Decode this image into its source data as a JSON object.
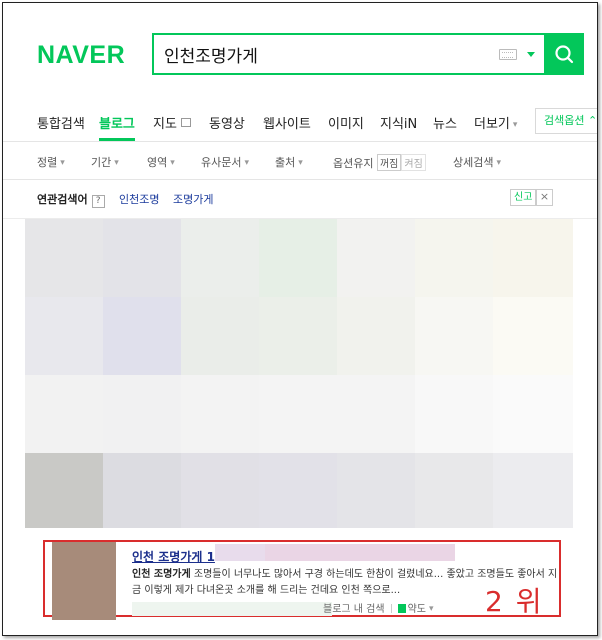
{
  "header": {
    "logo": "NAVER",
    "query": "인천조명가게"
  },
  "tabs": [
    {
      "label": "통합검색"
    },
    {
      "label": "블로그"
    },
    {
      "label": "지도"
    },
    {
      "label": "동영상"
    },
    {
      "label": "웹사이트"
    },
    {
      "label": "이미지"
    },
    {
      "label": "지식iN"
    },
    {
      "label": "뉴스"
    },
    {
      "label": "더보기"
    }
  ],
  "search_options_label": "검색옵션",
  "filters": {
    "sort": "정렬",
    "period": "기간",
    "area": "영역",
    "similar": "유사문서",
    "source": "출처",
    "keep_label": "옵션유지",
    "keep_off": "꺼짐",
    "keep_on": "켜짐",
    "detail": "상세검색"
  },
  "related": {
    "title": "연관검색어",
    "help": "?",
    "items": [
      "인천조명",
      "조명가게"
    ],
    "report": "신고",
    "close": "×"
  },
  "result": {
    "title": "인천 조명가게 1",
    "desc_bold": "인천 조명가게",
    "desc_text": " 조명들이 너무나도 많아서 구경 하는데도 한참이 걸렸네요... 좋았고 조명들도 좋아서 지금 이렇게 제가 다녀온곳 소개를 해 드리는 건데요 인천 쪽으로...",
    "blog_search": "블로그 내 검색",
    "map": "약도",
    "rank_annotation": "2 위"
  },
  "colors": {
    "brand": "#03c75a",
    "annotation": "#d92d2d",
    "link": "#1b2f8c"
  },
  "icons": [
    "search-icon",
    "keyboard-icon",
    "dropdown-arrow-icon",
    "close-icon",
    "map-icon"
  ]
}
